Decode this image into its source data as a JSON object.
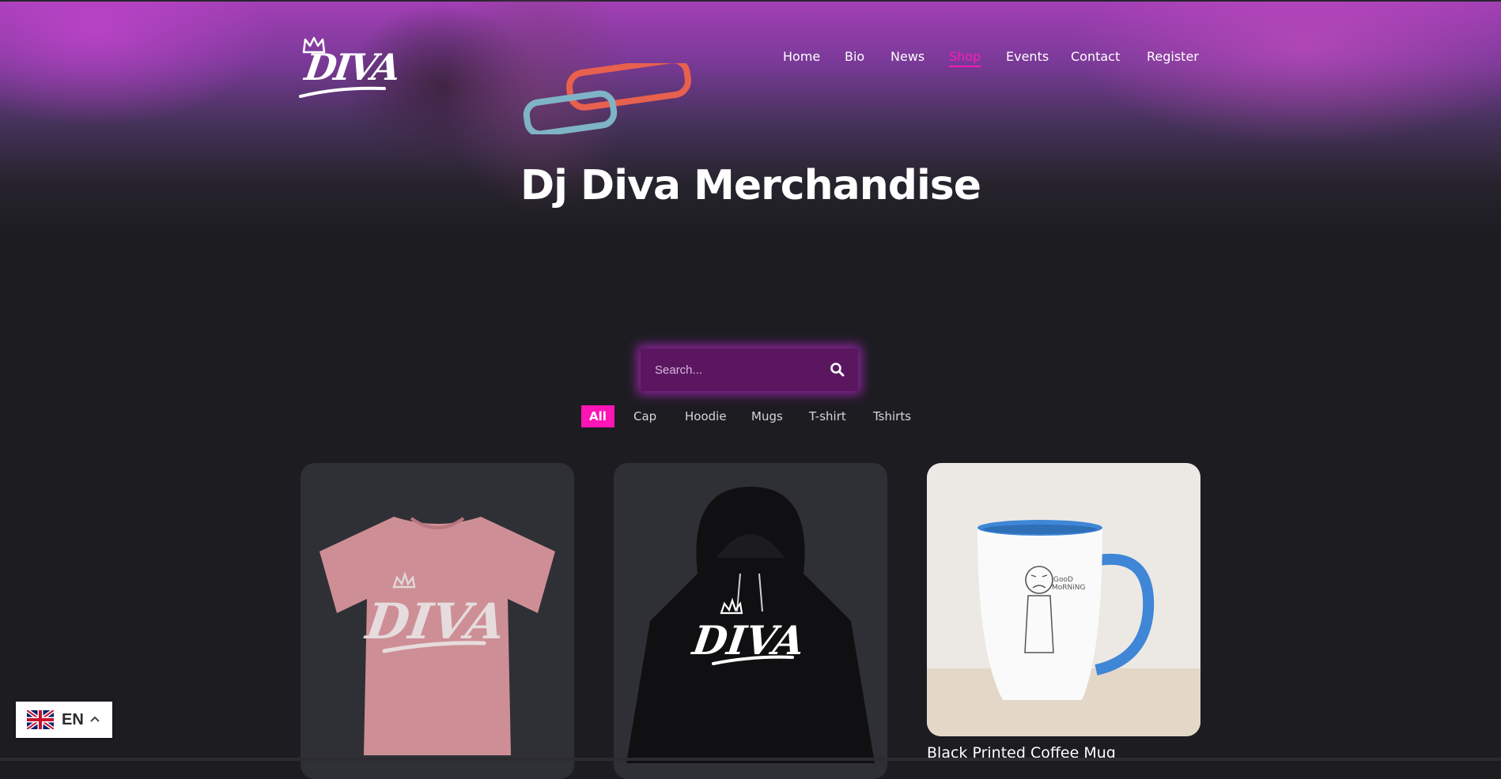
{
  "brand": {
    "logo_text": "DIVA"
  },
  "nav": {
    "items": [
      {
        "label": "Home"
      },
      {
        "label": "Bio"
      },
      {
        "label": "News"
      },
      {
        "label": "Shop",
        "active": true
      },
      {
        "label": "Events"
      },
      {
        "label": "Contact"
      },
      {
        "label": "Register"
      }
    ]
  },
  "hero": {
    "title": "Dj Diva Merchandise"
  },
  "search": {
    "placeholder": "Search...",
    "icon": "search-icon"
  },
  "filters": [
    {
      "label": "All",
      "active": true
    },
    {
      "label": "Cap"
    },
    {
      "label": "Hoodie"
    },
    {
      "label": "Mugs"
    },
    {
      "label": "T-shirt"
    },
    {
      "label": "Tshirts"
    }
  ],
  "products": [
    {
      "image": "pink-tshirt-diva-logo",
      "name": ""
    },
    {
      "image": "black-hoodie-diva-logo",
      "name": ""
    },
    {
      "image": "white-coffee-mug",
      "name": "Black Printed Coffee Mug"
    }
  ],
  "language": {
    "code": "EN",
    "flag": "uk-flag-icon",
    "chevron": "chevron-up-icon"
  },
  "colors": {
    "accent": "#ff14b5",
    "background": "#1c1c21",
    "card": "#2f3036",
    "search_bg": "#5a1760"
  }
}
